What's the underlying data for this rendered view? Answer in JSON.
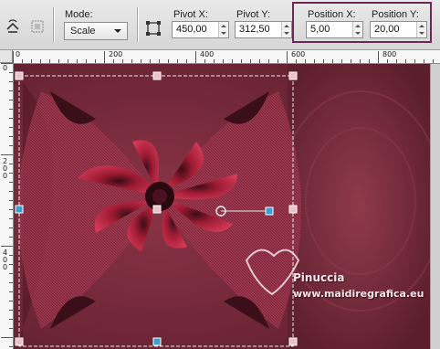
{
  "toolbar": {
    "icons": [
      "reset-icon",
      "pick-icon",
      "pivot-icon"
    ],
    "mode": {
      "label": "Mode:",
      "value": "Scale"
    },
    "pivot_x": {
      "label": "Pivot X:",
      "value": "450,00"
    },
    "pivot_y": {
      "label": "Pivot Y:",
      "value": "312,50"
    },
    "position_x": {
      "label": "Position X:",
      "value": "5,00"
    },
    "position_y": {
      "label": "Position Y:",
      "value": "20,00"
    },
    "highlight_color": "#6b2a55"
  },
  "ruler_top": {
    "labels": [
      "0",
      "200",
      "400",
      "600",
      "800"
    ]
  },
  "ruler_left": {
    "labels": [
      "0",
      "200",
      "400"
    ]
  },
  "watermark": {
    "line1": "Pinuccia",
    "line2": "www.maidiregrafica.eu"
  },
  "colors": {
    "canvas_dark": "#5a1d2b",
    "canvas_mid": "#8a3446",
    "flower": "#b01c38",
    "handle": "#3aa0d0"
  }
}
